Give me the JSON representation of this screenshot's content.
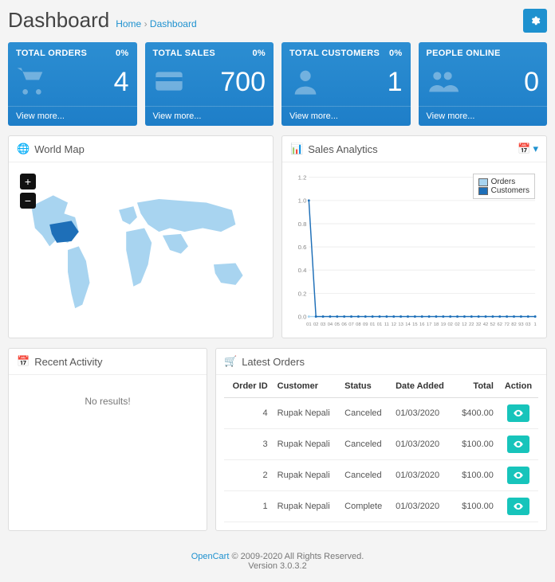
{
  "header": {
    "title": "Dashboard",
    "breadcrumb_home": "Home",
    "breadcrumb_sep": "›",
    "breadcrumb_current": "Dashboard"
  },
  "tiles": [
    {
      "label": "TOTAL ORDERS",
      "pct": "0%",
      "value": "4",
      "view_more": "View more...",
      "icon": "cart"
    },
    {
      "label": "TOTAL SALES",
      "pct": "0%",
      "value": "700",
      "view_more": "View more...",
      "icon": "card"
    },
    {
      "label": "TOTAL CUSTOMERS",
      "pct": "0%",
      "value": "1",
      "view_more": "View more...",
      "icon": "person"
    },
    {
      "label": "PEOPLE ONLINE",
      "pct": "",
      "value": "0",
      "view_more": "View more...",
      "icon": "people"
    }
  ],
  "worldmap": {
    "title": "World Map"
  },
  "analytics": {
    "title": "Sales Analytics",
    "legend_orders": "Orders",
    "legend_customers": "Customers"
  },
  "chart_data": {
    "type": "line",
    "x": [
      "01",
      "02",
      "03",
      "04",
      "05",
      "06",
      "07",
      "08",
      "09",
      "01",
      "01",
      "11",
      "12",
      "13",
      "14",
      "15",
      "16",
      "17",
      "18",
      "19",
      "02",
      "02",
      "12",
      "22",
      "32",
      "42",
      "52",
      "62",
      "72",
      "82",
      "93",
      "03",
      "1"
    ],
    "series": [
      {
        "name": "Orders",
        "values": [
          0,
          0,
          0,
          0,
          0,
          0,
          0,
          0,
          0,
          0,
          0,
          0,
          0,
          0,
          0,
          0,
          0,
          0,
          0,
          0,
          0,
          0,
          0,
          0,
          0,
          0,
          0,
          0,
          0,
          0,
          0,
          0,
          0
        ]
      },
      {
        "name": "Customers",
        "values": [
          1,
          0,
          0,
          0,
          0,
          0,
          0,
          0,
          0,
          0,
          0,
          0,
          0,
          0,
          0,
          0,
          0,
          0,
          0,
          0,
          0,
          0,
          0,
          0,
          0,
          0,
          0,
          0,
          0,
          0,
          0,
          0,
          0
        ]
      }
    ],
    "ylim": [
      0,
      1.2
    ],
    "yticks": [
      "0.0",
      "0.2",
      "0.4",
      "0.6",
      "0.8",
      "1.0",
      "1.2"
    ],
    "colors": {
      "Orders": "#a8d4f0",
      "Customers": "#1e6fb8"
    }
  },
  "recent": {
    "title": "Recent Activity",
    "empty": "No results!"
  },
  "latest": {
    "title": "Latest Orders",
    "columns": {
      "order_id": "Order ID",
      "customer": "Customer",
      "status": "Status",
      "date": "Date Added",
      "total": "Total",
      "action": "Action"
    },
    "rows": [
      {
        "id": "4",
        "customer": "Rupak Nepali",
        "status": "Canceled",
        "date": "01/03/2020",
        "total": "$400.00"
      },
      {
        "id": "3",
        "customer": "Rupak Nepali",
        "status": "Canceled",
        "date": "01/03/2020",
        "total": "$100.00"
      },
      {
        "id": "2",
        "customer": "Rupak Nepali",
        "status": "Canceled",
        "date": "01/03/2020",
        "total": "$100.00"
      },
      {
        "id": "1",
        "customer": "Rupak Nepali",
        "status": "Complete",
        "date": "01/03/2020",
        "total": "$100.00"
      }
    ]
  },
  "footer": {
    "brand": "OpenCart",
    "rights": " © 2009-2020 All Rights Reserved.",
    "version": "Version 3.0.3.2"
  }
}
